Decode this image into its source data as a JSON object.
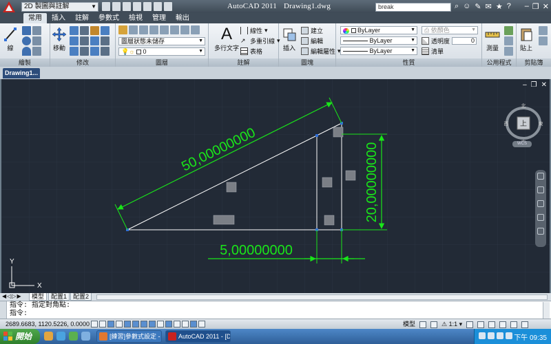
{
  "window": {
    "title_app": "AutoCAD 2011",
    "title_doc": "Drawing1.dwg",
    "workspace": "2D 製圖與註解",
    "search_value": "break"
  },
  "ribbon_tabs": [
    "常用",
    "插入",
    "註解",
    "參數式",
    "檢視",
    "管理",
    "輸出"
  ],
  "panels": {
    "draw": {
      "title": "繪製",
      "line_label": "線"
    },
    "modify": {
      "title": "修改",
      "move_label": "移動"
    },
    "layers": {
      "title": "圖層",
      "layer_state": "圖層狀態未儲存",
      "current_layer": "0"
    },
    "annotation": {
      "title": "註解",
      "mtext_label": "多行文字",
      "linear_label": "線性",
      "mleader_label": "多重引線",
      "table_label": "表格"
    },
    "block": {
      "title": "圖塊",
      "insert_label": "插入",
      "create_label": "建立",
      "edit_label": "編輯",
      "edit_attr_label": "編輯屬性"
    },
    "properties": {
      "title": "性質",
      "color": "ByLayer",
      "linetype": "ByLayer",
      "lineweight": "ByLayer",
      "transparency_label": "透明度",
      "transparency_value": "0",
      "list_label": "清單",
      "plot_style": "依顏色"
    },
    "utilities": {
      "title": "公用程式",
      "measure_label": "測量"
    },
    "clipboard": {
      "title": "剪貼簿",
      "paste_label": "貼上"
    }
  },
  "document_tab": "Drawing1...",
  "drawing": {
    "dim_hypotenuse": "50,00000000",
    "dim_vertical": "20,00000000",
    "dim_horizontal": "5,00000000",
    "axis_y": "Y",
    "axis_x": "X",
    "stroke_color": "#ffffff",
    "dim_color": "#19e619",
    "grip_color": "#2f6fd8"
  },
  "viewcube": {
    "north": "北",
    "south": "南",
    "east": "東",
    "west": "西",
    "top": "上",
    "wcs": "WCS"
  },
  "layout_tabs": [
    "模型",
    "配置1",
    "配置2"
  ],
  "command_lines": [
    "指令:  指定對角點:",
    "指令:"
  ],
  "status": {
    "coordinates": "2689.6683, 1120.5226, 0.0000",
    "model_label": "模型",
    "scale_label": "1:1"
  },
  "taskbar": {
    "start_label": "開始",
    "tasks": [
      "[練習]參數式設定 - ...",
      "AutoCAD 2011 - [Dra..."
    ],
    "clock": "下午 09:35"
  }
}
